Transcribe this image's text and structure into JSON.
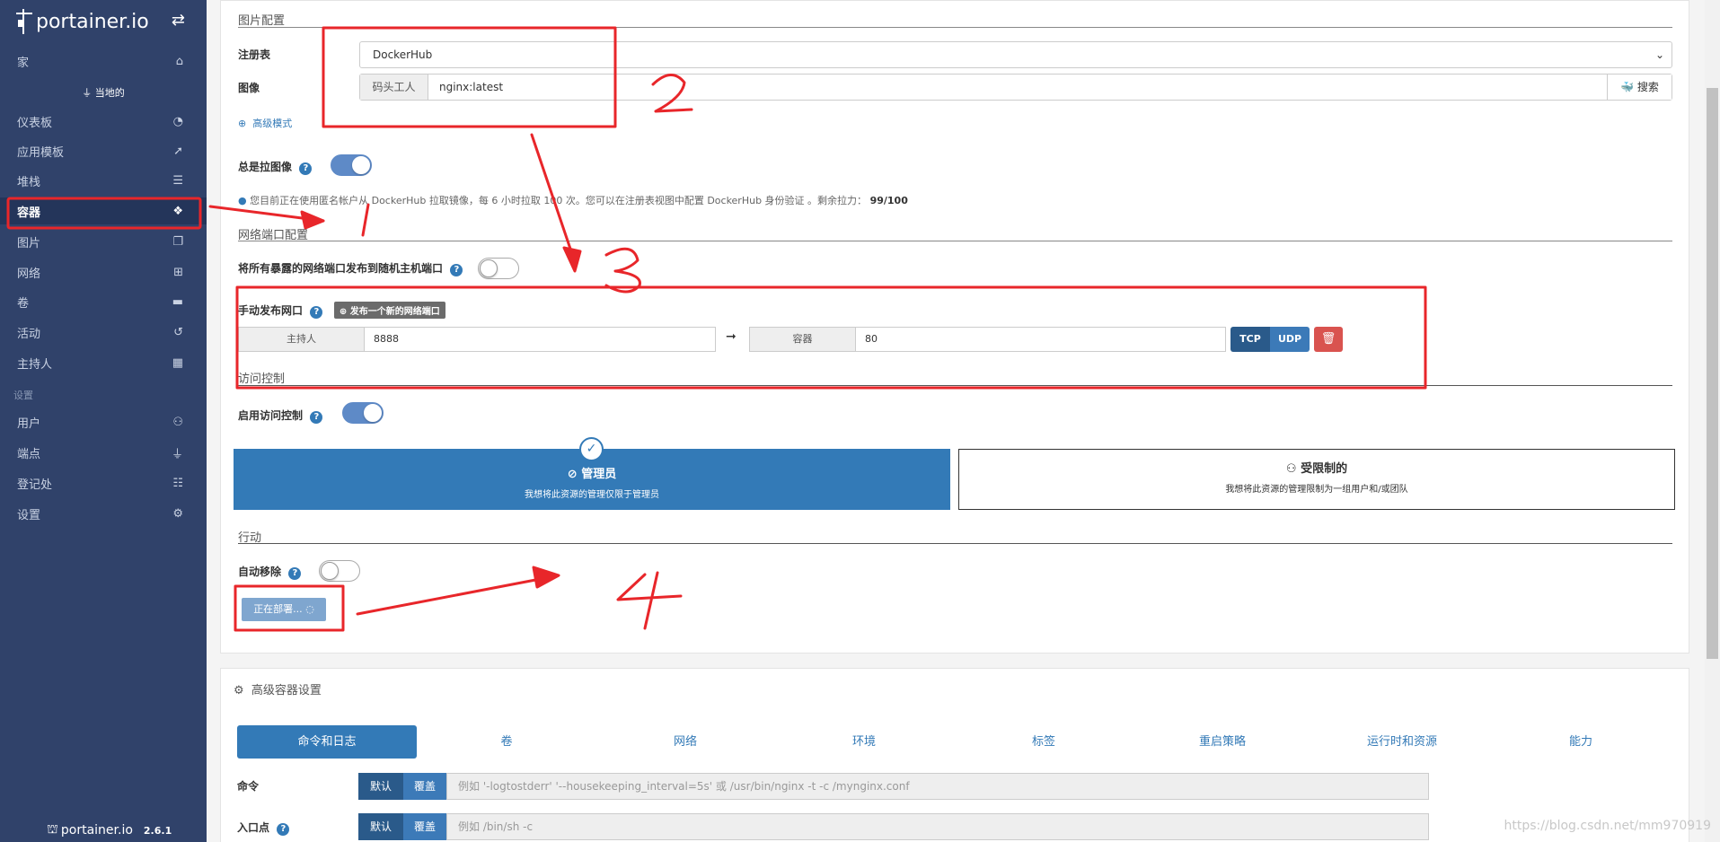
{
  "sidebar": {
    "logo": "portainer.io",
    "home": "家",
    "endpoint": "当地的",
    "items": [
      {
        "label": "仪表板",
        "icon": "tachometer-icon"
      },
      {
        "label": "应用模板",
        "icon": "rocket-icon"
      },
      {
        "label": "堆栈",
        "icon": "list-icon"
      },
      {
        "label": "容器",
        "icon": "cubes-icon"
      },
      {
        "label": "图片",
        "icon": "clone-icon"
      },
      {
        "label": "网络",
        "icon": "sitemap-icon"
      },
      {
        "label": "卷",
        "icon": "hdd-icon"
      },
      {
        "label": "活动",
        "icon": "history-icon"
      },
      {
        "label": "主持人",
        "icon": "th-icon"
      }
    ],
    "settings_section": "设置",
    "settings_items": [
      {
        "label": "用户",
        "icon": "users-icon"
      },
      {
        "label": "端点",
        "icon": "plug-icon"
      },
      {
        "label": "登记处",
        "icon": "database-icon"
      },
      {
        "label": "设置",
        "icon": "cogs-icon"
      }
    ],
    "active_item": "容器",
    "footer_logo": "portainer.io",
    "version": "2.6.1"
  },
  "image_config": {
    "title": "图片配置",
    "registry_label": "注册表",
    "registry_value": "DockerHub",
    "image_label": "图像",
    "image_prefix": "码头工人",
    "image_value": "nginx:latest",
    "search_label": "搜索",
    "advanced_mode": "高级模式",
    "always_pull_label": "总是拉图像",
    "always_pull_on": true,
    "info_text": "您目前正在使用匿名帐户从 DockerHub 拉取镜像，每 6 小时拉取 100 次。您可以在注册表视图中配置 DockerHub 身份验证 。剩余拉力：",
    "remaining_pulls": "99/100"
  },
  "network_ports": {
    "title": "网络端口配置",
    "publish_all_label": "将所有暴露的网络端口发布到随机主机端口",
    "publish_all_on": false,
    "manual_label": "手动发布网口",
    "add_port_button": "发布一个新的网络端口",
    "host_label": "主持人",
    "host_value": "8888",
    "container_label": "容器",
    "container_value": "80",
    "tcp": "TCP",
    "udp": "UDP"
  },
  "access_control": {
    "title": "访问控制",
    "enable_label": "启用访问控制",
    "enable_on": true,
    "admin_title": "管理员",
    "admin_desc": "我想将此资源的管理仅限于管理员",
    "restricted_title": "受限制的",
    "restricted_desc": "我想将此资源的管理限制为一组用户和/或团队"
  },
  "actions": {
    "title": "行动",
    "auto_remove_label": "自动移除",
    "auto_remove_on": false,
    "deploy_button": "正在部署..."
  },
  "advanced": {
    "title": "高级容器设置",
    "tabs": [
      "命令和日志",
      "卷",
      "网络",
      "环境",
      "标签",
      "重启策略",
      "运行时和资源",
      "能力"
    ],
    "active_tab": "命令和日志",
    "command_label": "命令",
    "command_default": "默认",
    "command_override": "覆盖",
    "command_placeholder": "例如 '-logtostderr' '--housekeeping_interval=5s' 或 /usr/bin/nginx -t -c /mynginx.conf",
    "entrypoint_label": "入口点",
    "entrypoint_default": "默认",
    "entrypoint_override": "覆盖",
    "entrypoint_placeholder": "例如 /bin/sh -c"
  },
  "watermark": "https://blog.csdn.net/mm970919",
  "colors": {
    "sidebar_bg": "#30426a",
    "primary": "#337ab7",
    "danger": "#d9534f",
    "annotation": "#e8262a"
  }
}
